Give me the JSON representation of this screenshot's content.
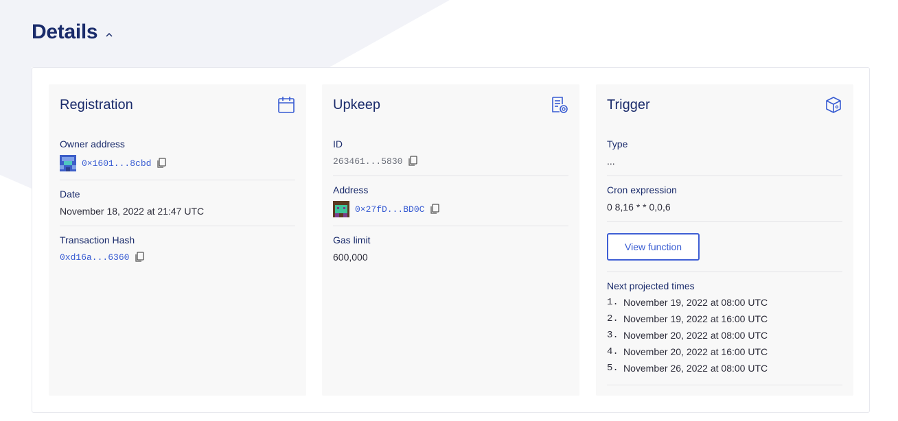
{
  "header": {
    "title": "Details"
  },
  "registration": {
    "title": "Registration",
    "owner_label": "Owner address",
    "owner_value": "0×1601...8cbd",
    "date_label": "Date",
    "date_value": "November 18, 2022 at 21:47 UTC",
    "tx_label": "Transaction Hash",
    "tx_value": "0xd16a...6360"
  },
  "upkeep": {
    "title": "Upkeep",
    "id_label": "ID",
    "id_value": "263461...5830",
    "address_label": "Address",
    "address_value": "0×27fD...BD0C",
    "gas_label": "Gas limit",
    "gas_value": "600,000"
  },
  "trigger": {
    "title": "Trigger",
    "type_label": "Type",
    "type_value": "...",
    "cron_label": "Cron expression",
    "cron_value": "0 8,16 * * 0,0,6",
    "view_button": "View function",
    "times_label": "Next projected times",
    "times": [
      {
        "n": "1.",
        "t": "November 19, 2022 at 08:00 UTC"
      },
      {
        "n": "2.",
        "t": "November 19, 2022 at 16:00 UTC"
      },
      {
        "n": "3.",
        "t": "November 20, 2022 at 08:00 UTC"
      },
      {
        "n": "4.",
        "t": "November 20, 2022 at 16:00 UTC"
      },
      {
        "n": "5.",
        "t": "November 26, 2022 at 08:00 UTC"
      }
    ]
  },
  "colors": {
    "navy": "#1a2b6b",
    "accent": "#375bd2",
    "card_bg": "#f8f8f8",
    "bg_shape": "#f2f3f8"
  },
  "icons": {
    "collapse": "chevron-up-icon",
    "registration": "calendar-icon",
    "upkeep": "document-gear-icon",
    "trigger": "cube-icon",
    "copy": "copy-icon"
  }
}
